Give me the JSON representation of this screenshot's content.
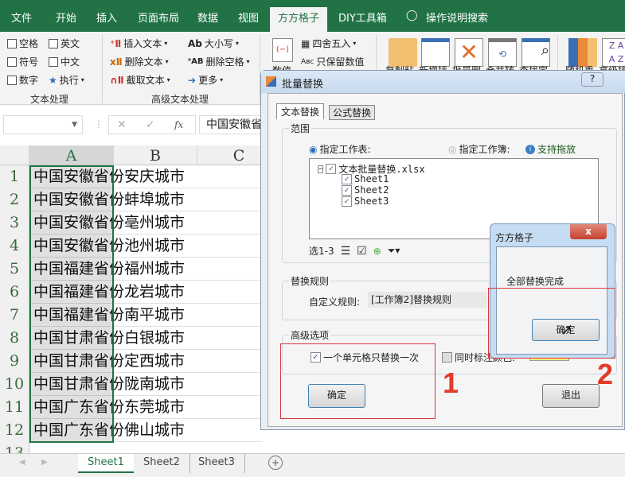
{
  "ribbon_tabs": [
    "文件",
    "开始",
    "插入",
    "页面布局",
    "数据",
    "视图",
    "方方格子",
    "DIY工具箱",
    "操作说明搜索"
  ],
  "active_tab": "方方格子",
  "ribbon": {
    "text_group": {
      "label": "文本处理",
      "items": [
        "空格",
        "英文",
        "符号",
        "中文",
        "数字",
        "执行"
      ]
    },
    "adv_group": {
      "label": "高级文本处理",
      "items": [
        "插入文本",
        "删除文本",
        "截取文本",
        "大小写",
        "删除空格",
        "更多"
      ]
    },
    "numeric": {
      "label": "数值",
      "items": [
        "四舍五入",
        "只保留数值"
      ]
    },
    "big_buttons": [
      "复制粘",
      "新增插",
      "批量删",
      "合并转",
      "查找定",
      "随机重",
      "高级排"
    ]
  },
  "formula_bar": {
    "content": "中国安徽省"
  },
  "columns": [
    "A",
    "B",
    "C"
  ],
  "rows": [
    {
      "n": "1",
      "v": "中国安徽省份安庆城市"
    },
    {
      "n": "2",
      "v": "中国安徽省份蚌埠城市"
    },
    {
      "n": "3",
      "v": "中国安徽省份亳州城市"
    },
    {
      "n": "4",
      "v": "中国安徽省份池州城市"
    },
    {
      "n": "5",
      "v": "中国福建省份福州城市"
    },
    {
      "n": "6",
      "v": "中国福建省份龙岩城市"
    },
    {
      "n": "7",
      "v": "中国福建省份南平城市"
    },
    {
      "n": "8",
      "v": "中国甘肃省份白银城市"
    },
    {
      "n": "9",
      "v": "中国甘肃省份定西城市"
    },
    {
      "n": "10",
      "v": "中国甘肃省份陇南城市"
    },
    {
      "n": "11",
      "v": "中国广东省份东莞城市"
    },
    {
      "n": "12",
      "v": "中国广东省份佛山城市"
    },
    {
      "n": "13",
      "v": ""
    }
  ],
  "sheet_tabs": [
    "Sheet1",
    "Sheet2",
    "Sheet3"
  ],
  "dialog": {
    "title": "批量替换",
    "help": "?",
    "tabs": [
      "文本替换",
      "公式替换"
    ],
    "range": {
      "label": "范围",
      "opt_sheet": "指定工作表:",
      "opt_book": "指定工作簿:",
      "drag_hint": "支持拖放",
      "tree_root": "文本批量替换.xlsx",
      "tree_children": [
        "Sheet1",
        "Sheet2",
        "Sheet3"
      ],
      "select_label": "选1-3"
    },
    "rules": {
      "label": "替换规则",
      "custom_label": "自定义规则:",
      "custom_value": "[工作簿2]替换规则"
    },
    "advanced": {
      "label": "高级选项",
      "once": "一个单元格只替换一次",
      "mark_color": "同时标注颜色:",
      "color": "#fff27a"
    },
    "ok": "确定",
    "exit": "退出"
  },
  "message_box": {
    "title": "方方格子",
    "close": "x",
    "text": "全部替换完成",
    "ok": "确定"
  },
  "annotations": [
    "1",
    "2"
  ]
}
